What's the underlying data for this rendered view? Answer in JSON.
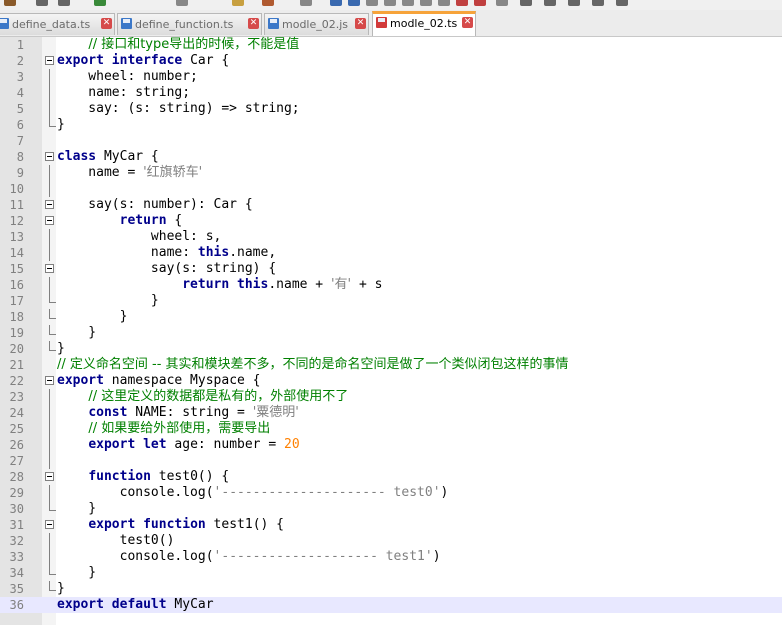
{
  "theme": {
    "keyword_color": "#00008b",
    "comment_color": "#008000",
    "string_color": "#808080",
    "number_color": "#ff8000",
    "active_tab_accent": "#f6a33a",
    "current_line_color": "#e8e8ff"
  },
  "tabs": [
    {
      "label": "define_data.ts",
      "active": false,
      "icon": "floppy-disk-icon"
    },
    {
      "label": "define_function.ts",
      "active": false,
      "icon": "floppy-disk-icon"
    },
    {
      "label": "modle_02.js",
      "active": false,
      "icon": "floppy-disk-icon"
    },
    {
      "label": "modle_02.ts",
      "active": true,
      "icon": "floppy-disk-red-icon"
    }
  ],
  "editor": {
    "current_line": 36,
    "lines": [
      {
        "n": "1",
        "fold": "none",
        "tokens": [
          [
            "    ",
            ""
          ],
          [
            "// 接口和type导出的时候，不能是值",
            "cm"
          ]
        ]
      },
      {
        "n": "2",
        "fold": "open",
        "tokens": [
          [
            "export",
            "kw"
          ],
          [
            " ",
            ""
          ],
          [
            "interface",
            "kw"
          ],
          [
            " Car {",
            ""
          ]
        ]
      },
      {
        "n": "3",
        "fold": "line",
        "tokens": [
          [
            "    wheel: number;",
            ""
          ]
        ]
      },
      {
        "n": "4",
        "fold": "line",
        "tokens": [
          [
            "    name: string;",
            ""
          ]
        ]
      },
      {
        "n": "5",
        "fold": "line",
        "tokens": [
          [
            "    say: (s: string) => string;",
            ""
          ]
        ]
      },
      {
        "n": "6",
        "fold": "end",
        "tokens": [
          [
            "}",
            ""
          ]
        ]
      },
      {
        "n": "7",
        "fold": "none",
        "tokens": []
      },
      {
        "n": "8",
        "fold": "open",
        "tokens": [
          [
            "class",
            "kw"
          ],
          [
            " MyCar {",
            ""
          ]
        ]
      },
      {
        "n": "9",
        "fold": "line",
        "tokens": [
          [
            "    name = ",
            ""
          ],
          [
            "'红旗轿车'",
            "str"
          ]
        ]
      },
      {
        "n": "10",
        "fold": "line",
        "tokens": []
      },
      {
        "n": "11",
        "fold": "open",
        "tokens": [
          [
            "    say(s: number): Car {",
            ""
          ]
        ]
      },
      {
        "n": "12",
        "fold": "open",
        "tokens": [
          [
            "        ",
            ""
          ],
          [
            "return",
            "kw"
          ],
          [
            " {",
            ""
          ]
        ]
      },
      {
        "n": "13",
        "fold": "line",
        "tokens": [
          [
            "            wheel: s,",
            ""
          ]
        ]
      },
      {
        "n": "14",
        "fold": "line",
        "tokens": [
          [
            "            name: ",
            ""
          ],
          [
            "this",
            "kw"
          ],
          [
            ".name,",
            ""
          ]
        ]
      },
      {
        "n": "15",
        "fold": "open",
        "tokens": [
          [
            "            say(s: string) {",
            ""
          ]
        ]
      },
      {
        "n": "16",
        "fold": "line",
        "tokens": [
          [
            "                ",
            ""
          ],
          [
            "return",
            "kw"
          ],
          [
            " ",
            ""
          ],
          [
            "this",
            "kw"
          ],
          [
            ".name + ",
            ""
          ],
          [
            "'有'",
            "str"
          ],
          [
            " + s",
            ""
          ]
        ]
      },
      {
        "n": "17",
        "fold": "end",
        "tokens": [
          [
            "            }",
            ""
          ]
        ]
      },
      {
        "n": "18",
        "fold": "end",
        "tokens": [
          [
            "        }",
            ""
          ]
        ]
      },
      {
        "n": "19",
        "fold": "end",
        "tokens": [
          [
            "    }",
            ""
          ]
        ]
      },
      {
        "n": "20",
        "fold": "end",
        "tokens": [
          [
            "}",
            ""
          ]
        ]
      },
      {
        "n": "21",
        "fold": "none",
        "tokens": [
          [
            "// 定义命名空间 -- 其实和模块差不多，不同的是命名空间是做了一个类似闭包这样的事情",
            "cm"
          ]
        ]
      },
      {
        "n": "22",
        "fold": "open",
        "tokens": [
          [
            "export",
            "kw"
          ],
          [
            " namespace Myspace {",
            ""
          ]
        ]
      },
      {
        "n": "23",
        "fold": "line",
        "tokens": [
          [
            "    ",
            ""
          ],
          [
            "// 这里定义的数据都是私有的，外部使用不了",
            "cm"
          ]
        ]
      },
      {
        "n": "24",
        "fold": "line",
        "tokens": [
          [
            "    ",
            ""
          ],
          [
            "const",
            "kw"
          ],
          [
            " NAME: string = ",
            ""
          ],
          [
            "'粟德明'",
            "str"
          ]
        ]
      },
      {
        "n": "25",
        "fold": "line",
        "tokens": [
          [
            "    ",
            ""
          ],
          [
            "// 如果要给外部使用，需要导出",
            "cm"
          ]
        ]
      },
      {
        "n": "26",
        "fold": "line",
        "tokens": [
          [
            "    ",
            ""
          ],
          [
            "export",
            "kw"
          ],
          [
            " ",
            ""
          ],
          [
            "let",
            "kw"
          ],
          [
            " age: number = ",
            ""
          ],
          [
            "20",
            "num"
          ]
        ]
      },
      {
        "n": "27",
        "fold": "line",
        "tokens": []
      },
      {
        "n": "28",
        "fold": "open",
        "tokens": [
          [
            "    ",
            ""
          ],
          [
            "function",
            "kw"
          ],
          [
            " test0() {",
            ""
          ]
        ]
      },
      {
        "n": "29",
        "fold": "line",
        "tokens": [
          [
            "        console.log(",
            ""
          ],
          [
            "'--------------------- test0'",
            "str"
          ],
          [
            ")",
            ""
          ]
        ]
      },
      {
        "n": "30",
        "fold": "end",
        "tokens": [
          [
            "    }",
            ""
          ]
        ]
      },
      {
        "n": "31",
        "fold": "open",
        "tokens": [
          [
            "    ",
            ""
          ],
          [
            "export",
            "kw"
          ],
          [
            " ",
            ""
          ],
          [
            "function",
            "kw"
          ],
          [
            " test1() {",
            ""
          ]
        ]
      },
      {
        "n": "32",
        "fold": "line",
        "tokens": [
          [
            "        test0()",
            ""
          ]
        ]
      },
      {
        "n": "33",
        "fold": "line",
        "tokens": [
          [
            "        console.log(",
            ""
          ],
          [
            "'-------------------- test1'",
            "str"
          ],
          [
            ")",
            ""
          ]
        ]
      },
      {
        "n": "34",
        "fold": "end",
        "tokens": [
          [
            "    }",
            ""
          ]
        ]
      },
      {
        "n": "35",
        "fold": "end",
        "tokens": [
          [
            "}",
            ""
          ]
        ]
      },
      {
        "n": "36",
        "fold": "none",
        "tokens": [
          [
            "export",
            "kw"
          ],
          [
            " ",
            ""
          ],
          [
            "default",
            "kw"
          ],
          [
            " MyCar",
            ""
          ]
        ]
      }
    ]
  }
}
